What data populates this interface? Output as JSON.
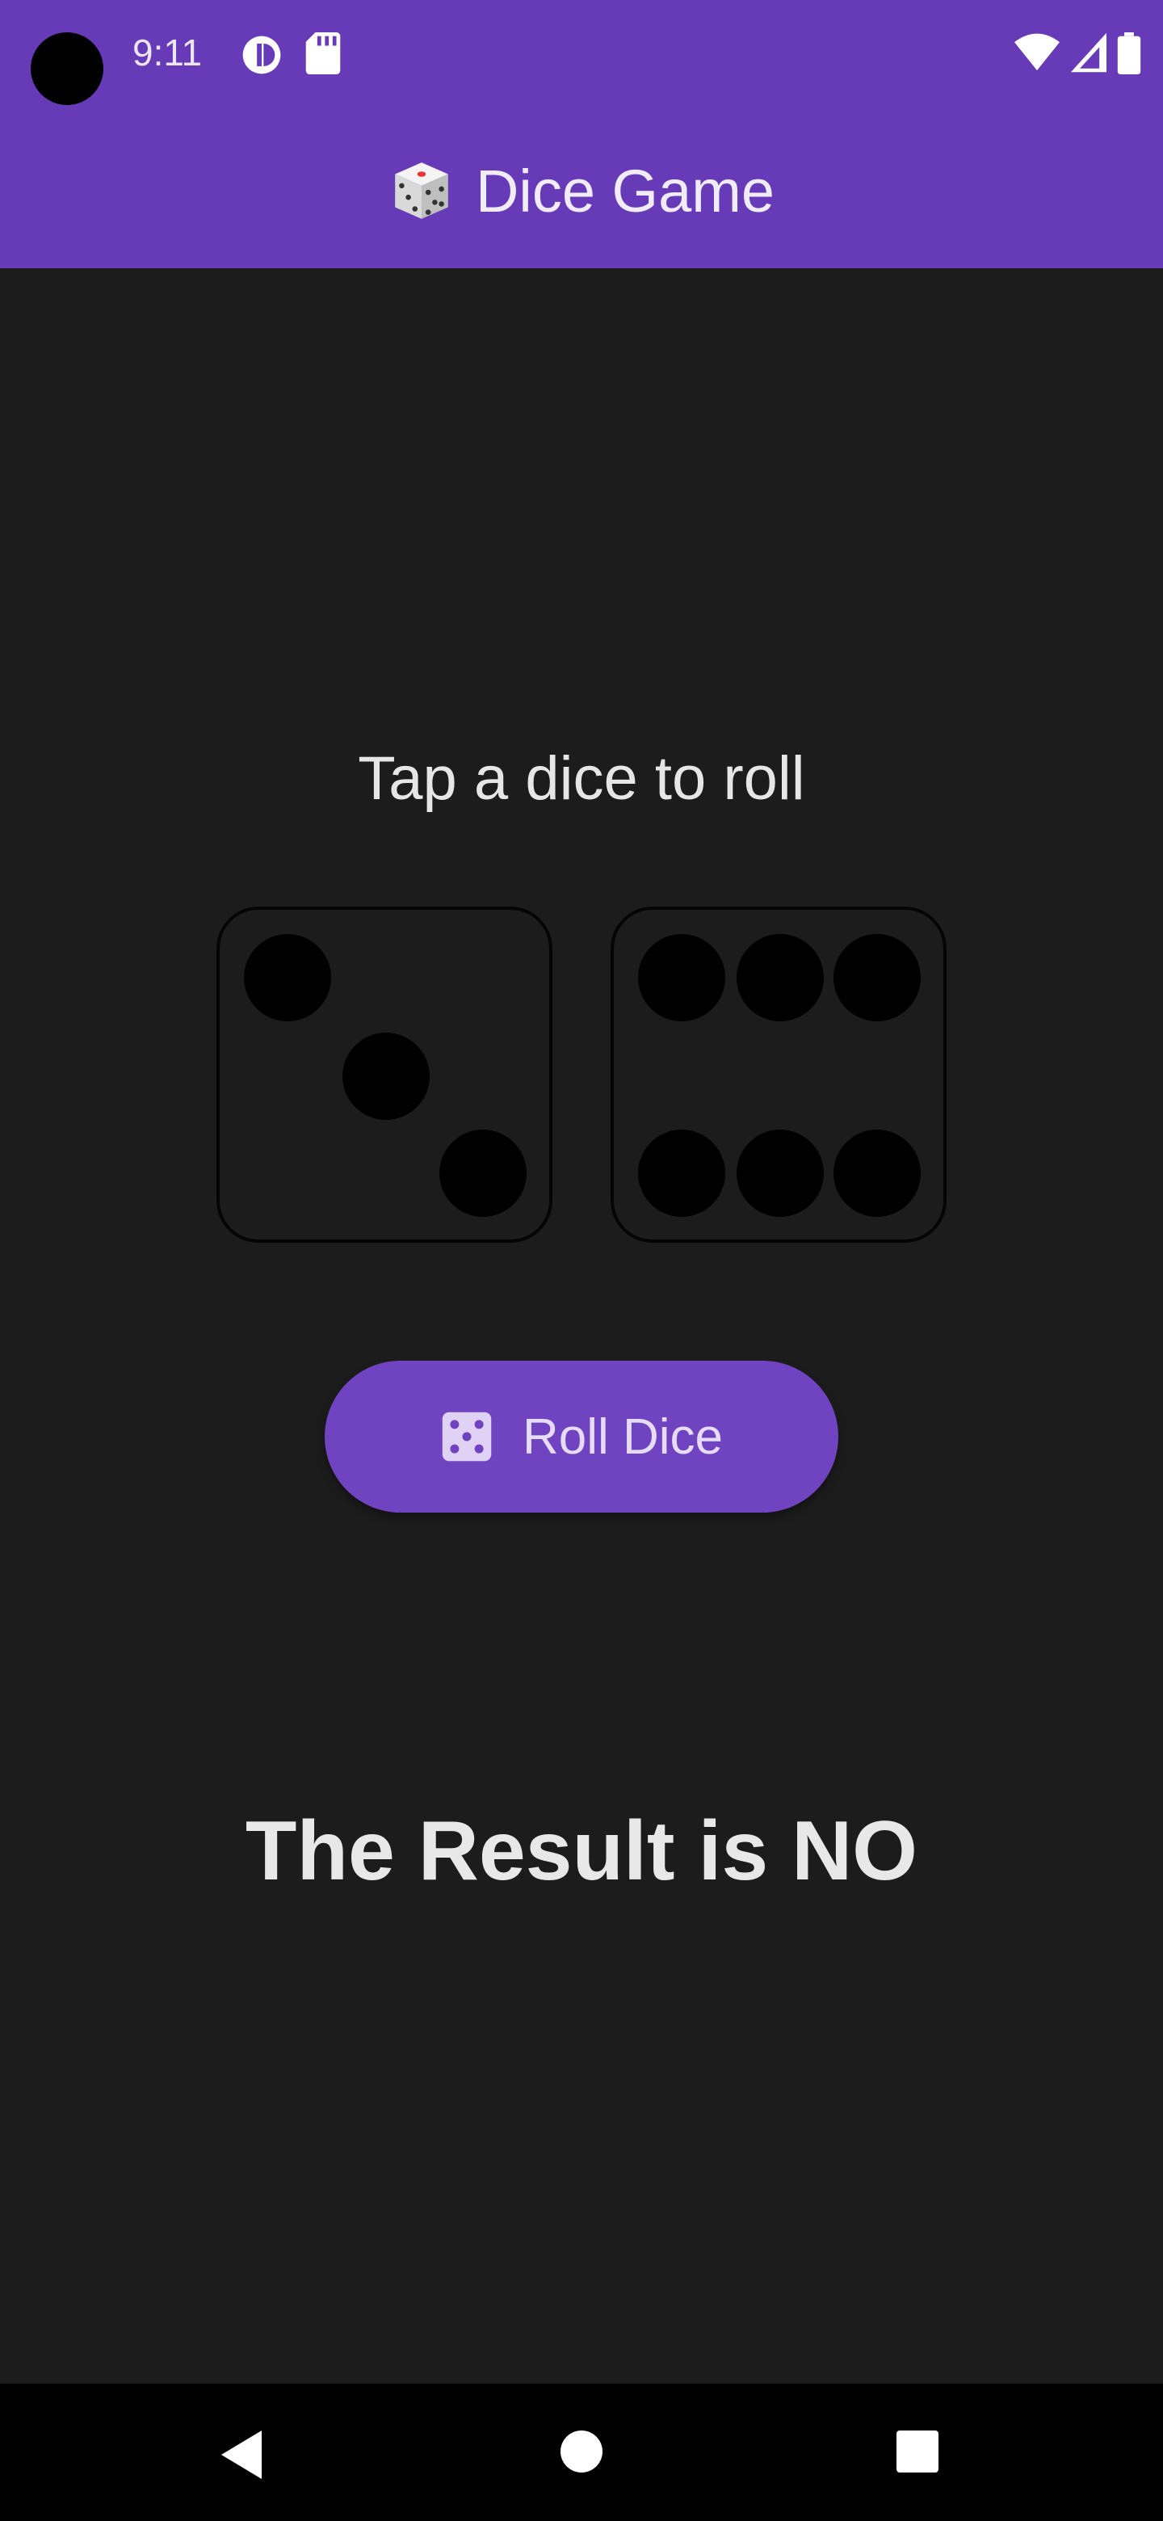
{
  "status_bar": {
    "time": "9:11",
    "left_icons": [
      "data-saver-icon",
      "sd-card-icon"
    ],
    "right_icons": [
      "wifi-icon",
      "cell-signal-icon",
      "battery-icon"
    ]
  },
  "app_bar": {
    "icon": "game-die-emoji",
    "title": "Dice Game"
  },
  "game": {
    "prompt": "Tap a dice to roll",
    "dice": [
      {
        "face": 3
      },
      {
        "face": 6
      }
    ],
    "roll_button": {
      "icon": "dice-five-icon",
      "label": "Roll Dice"
    },
    "result_text": "The Result is NO"
  },
  "colors": {
    "primary": "#673ab7",
    "button": "#7043c0",
    "background": "#1c1c1c",
    "pip": "#000000"
  },
  "nav_bar": {
    "buttons": [
      "back-icon",
      "home-icon",
      "recents-icon"
    ]
  }
}
